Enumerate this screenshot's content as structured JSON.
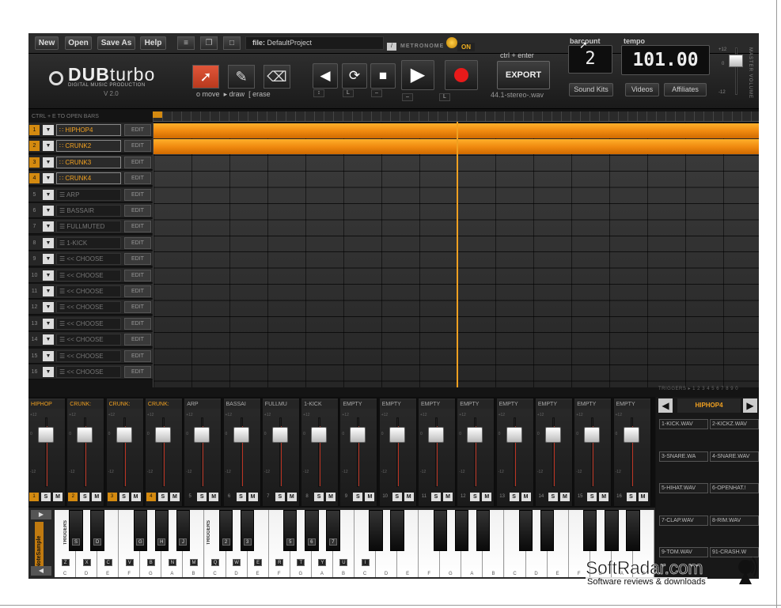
{
  "menu": {
    "new": "New",
    "open": "Open",
    "save_as": "Save As",
    "help": "Help",
    "file_label": "file:",
    "file_name": "DefaultProject"
  },
  "metronome": {
    "label": "METRONOME",
    "state": "ON"
  },
  "brand": {
    "name_a": "DUB",
    "name_b": "turbo",
    "tagline": "DIGITAL MUSIC PRODUCTION",
    "version": "V 2.0"
  },
  "tools": {
    "move": "move",
    "draw": "draw",
    "erase": "erase",
    "move_prefix": "o",
    "draw_prefix": "▸",
    "erase_prefix": "["
  },
  "transport_keys": [
    "↕",
    "L",
    "–",
    "–",
    "L"
  ],
  "export": {
    "hint": "ctrl + enter",
    "label": "EXPORT",
    "format": "44.1-stereo-.wav"
  },
  "barcount": {
    "label": "barcount",
    "value": "2"
  },
  "tempo": {
    "label": "tempo",
    "value": "101.00"
  },
  "links": {
    "sound_kits": "Sound Kits",
    "videos": "Videos",
    "affiliates": "Affiliates"
  },
  "master": {
    "label": "MASTER VOLUME",
    "top": "+12",
    "mid": "0",
    "bottom": "-12"
  },
  "sequencer": {
    "hint": "CTRL + E TO OPEN BARS",
    "triggers": "TRIGGERS ▸ 1 2 3 4 5 6 7 8 9 0"
  },
  "tracks": [
    {
      "num": "1",
      "name": "HIPHOP4",
      "edit": "EDIT",
      "active": true
    },
    {
      "num": "2",
      "name": "CRUNK2",
      "edit": "EDIT",
      "active": true
    },
    {
      "num": "3",
      "name": "CRUNK3",
      "edit": "EDIT",
      "active": true
    },
    {
      "num": "4",
      "name": "CRUNK4",
      "edit": "EDIT",
      "active": true
    },
    {
      "num": "5",
      "name": "ARP",
      "edit": "EDIT",
      "active": false
    },
    {
      "num": "6",
      "name": "BASSAIR",
      "edit": "EDIT",
      "active": false
    },
    {
      "num": "7",
      "name": "FULLMUTED",
      "edit": "EDIT",
      "active": false
    },
    {
      "num": "8",
      "name": "1-KICK",
      "edit": "EDIT",
      "active": false
    },
    {
      "num": "9",
      "name": "<< CHOOSE",
      "edit": "EDIT",
      "active": false
    },
    {
      "num": "10",
      "name": "<< CHOOSE",
      "edit": "EDIT",
      "active": false
    },
    {
      "num": "11",
      "name": "<< CHOOSE",
      "edit": "EDIT",
      "active": false
    },
    {
      "num": "12",
      "name": "<< CHOOSE",
      "edit": "EDIT",
      "active": false
    },
    {
      "num": "13",
      "name": "<< CHOOSE",
      "edit": "EDIT",
      "active": false
    },
    {
      "num": "14",
      "name": "<< CHOOSE",
      "edit": "EDIT",
      "active": false
    },
    {
      "num": "15",
      "name": "<< CHOOSE",
      "edit": "EDIT",
      "active": false
    },
    {
      "num": "16",
      "name": "<< CHOOSE",
      "edit": "EDIT",
      "active": false
    }
  ],
  "mixer": [
    {
      "name": "HIPHOP",
      "num": "1",
      "active": true
    },
    {
      "name": "CRUNK:",
      "num": "2",
      "active": true
    },
    {
      "name": "CRUNK:",
      "num": "3",
      "active": true
    },
    {
      "name": "CRUNK:",
      "num": "4",
      "active": true
    },
    {
      "name": "ARP",
      "num": "5",
      "active": false
    },
    {
      "name": "BASSAI",
      "num": "6",
      "active": false
    },
    {
      "name": "FULLMU",
      "num": "7",
      "active": false
    },
    {
      "name": "1-KICK",
      "num": "8",
      "active": false
    },
    {
      "name": "EMPTY",
      "num": "9",
      "active": false
    },
    {
      "name": "EMPTY",
      "num": "10",
      "active": false
    },
    {
      "name": "EMPTY",
      "num": "11",
      "active": false
    },
    {
      "name": "EMPTY",
      "num": "12",
      "active": false
    },
    {
      "name": "EMPTY",
      "num": "13",
      "active": false
    },
    {
      "name": "EMPTY",
      "num": "14",
      "active": false
    },
    {
      "name": "EMPTY",
      "num": "15",
      "active": false
    },
    {
      "name": "EMPTY",
      "num": "16",
      "active": false
    }
  ],
  "mixer_solo": "S",
  "mixer_mute": "M",
  "fader_marks": [
    "+12",
    "0",
    "-12"
  ],
  "kit": {
    "name": "HIPHOP4",
    "pads": [
      "1-KICK.WAV",
      "2-KICKZ.WAV",
      "3-SNARE.WA",
      "4-SNARE.WAV",
      "5-HIHAT.WAV",
      "6-OPENHAT.!",
      "7-CLAP.WAV",
      "8-RIM.WAV",
      "9-TOM.WAV",
      "91-CRASH.W"
    ]
  },
  "keyboard": {
    "instrument": "NoteSample",
    "triggers_label": "TRIGGERS",
    "white_notes": [
      "C",
      "D",
      "E",
      "F",
      "G",
      "A",
      "B",
      "C",
      "D",
      "E",
      "F",
      "G",
      "A",
      "B",
      "C",
      "D",
      "E",
      "F",
      "G",
      "A",
      "B",
      "C",
      "D",
      "E",
      "F",
      "G",
      "A",
      "B"
    ],
    "key_labels_black": [
      "S",
      "D",
      "G",
      "H",
      "J",
      "2",
      "3",
      "5",
      "6",
      "7"
    ],
    "key_labels_white": [
      "Z",
      "X",
      "C",
      "V",
      "B",
      "N",
      "M",
      "Q",
      "W",
      "E",
      "R",
      "T",
      "Y",
      "U",
      "I"
    ]
  },
  "watermark": {
    "title": "SoftRadar.com",
    "subtitle": "Software reviews & downloads"
  }
}
